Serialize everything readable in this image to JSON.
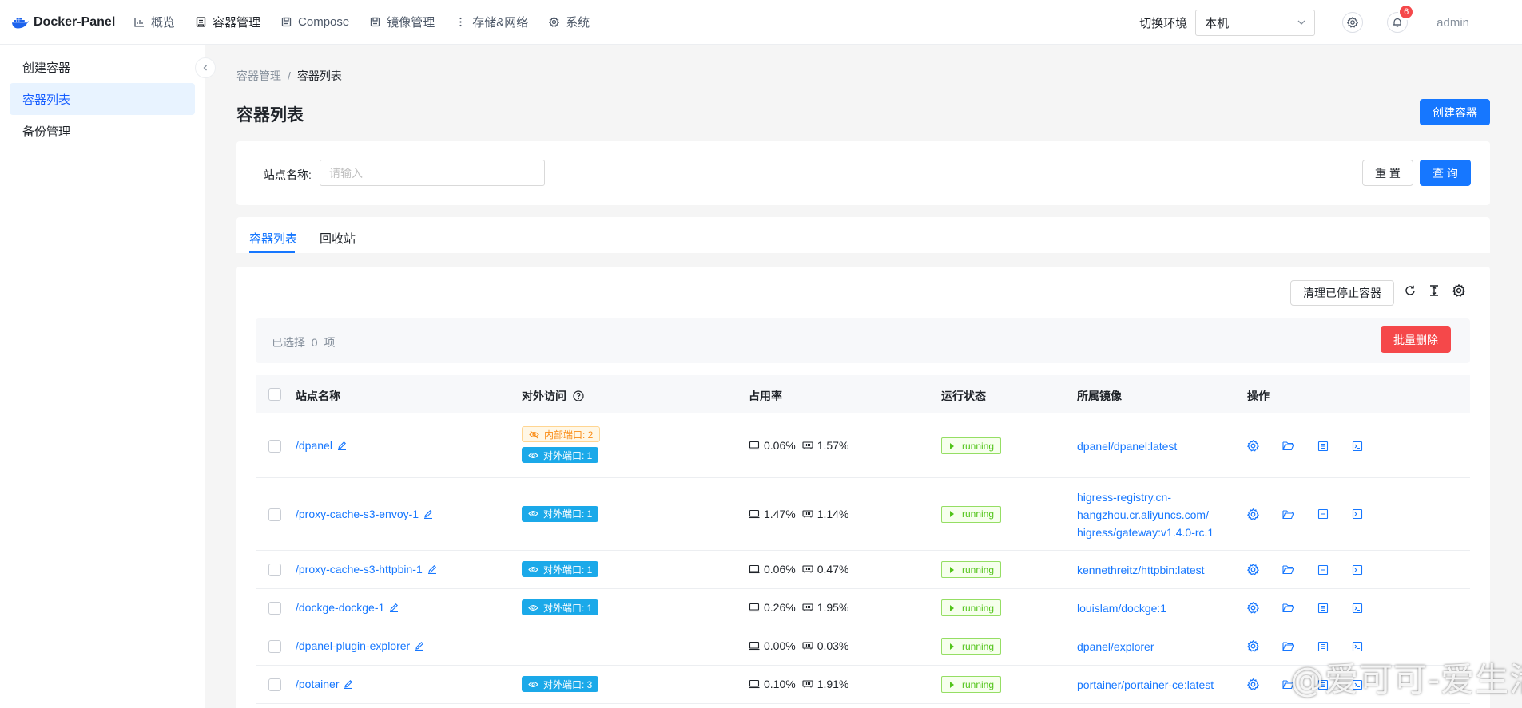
{
  "brand": {
    "name": "Docker-Panel"
  },
  "nav": [
    {
      "label": "概览",
      "icon": "chart-icon"
    },
    {
      "label": "容器管理",
      "icon": "container-icon"
    },
    {
      "label": "Compose",
      "icon": "compose-icon"
    },
    {
      "label": "镜像管理",
      "icon": "image-icon"
    },
    {
      "label": "存储&网络",
      "icon": "more-icon"
    },
    {
      "label": "系统",
      "icon": "gear-icon"
    }
  ],
  "header": {
    "env_label": "切换环境",
    "env_value": "本机",
    "notification_count": "6",
    "user": "admin"
  },
  "sidebar": {
    "items": [
      {
        "label": "创建容器"
      },
      {
        "label": "容器列表"
      },
      {
        "label": "备份管理"
      }
    ]
  },
  "breadcrumb": {
    "parent": "容器管理",
    "sep": "/",
    "current": "容器列表"
  },
  "page": {
    "title": "容器列表",
    "create_button": "创建容器"
  },
  "search": {
    "label": "站点名称:",
    "placeholder": "请输入",
    "reset_button": "重 置",
    "query_button": "查 询"
  },
  "tabs": [
    {
      "label": "容器列表"
    },
    {
      "label": "回收站"
    }
  ],
  "toolbar": {
    "clean_button": "清理已停止容器"
  },
  "selection": {
    "prefix": "已选择",
    "count": "0",
    "suffix": "项",
    "batch_delete": "批量删除"
  },
  "table": {
    "columns": [
      "站点名称",
      "对外访问",
      "占用率",
      "运行状态",
      "所属镜像",
      "操作"
    ],
    "rows": [
      {
        "name": "/dpanel",
        "internal": "内部端口: 2",
        "external": "对外端口: 1",
        "cpu": "0.06%",
        "mem": "1.57%",
        "status": "running",
        "image": "dpanel/dpanel:latest"
      },
      {
        "name": "/proxy-cache-s3-envoy-1",
        "internal": "",
        "external": "对外端口: 1",
        "cpu": "1.47%",
        "mem": "1.14%",
        "status": "running",
        "image": "higress-registry.cn-\nhangzhou.cr.aliyuncs.com/\nhigress/gateway:v1.4.0-rc.1"
      },
      {
        "name": "/proxy-cache-s3-httpbin-1",
        "internal": "",
        "external": "对外端口: 1",
        "cpu": "0.06%",
        "mem": "0.47%",
        "status": "running",
        "image": "kennethreitz/httpbin:latest"
      },
      {
        "name": "/dockge-dockge-1",
        "internal": "",
        "external": "对外端口: 1",
        "cpu": "0.26%",
        "mem": "1.95%",
        "status": "running",
        "image": "louislam/dockge:1"
      },
      {
        "name": "/dpanel-plugin-explorer",
        "internal": "",
        "external": "",
        "cpu": "0.00%",
        "mem": "0.03%",
        "status": "running",
        "image": "dpanel/explorer"
      },
      {
        "name": "/potainer",
        "internal": "",
        "external": "对外端口: 3",
        "cpu": "0.10%",
        "mem": "1.91%",
        "status": "running",
        "image": "portainer/portainer-ce:latest"
      }
    ]
  },
  "watermark": "@爱可可-爱生活"
}
